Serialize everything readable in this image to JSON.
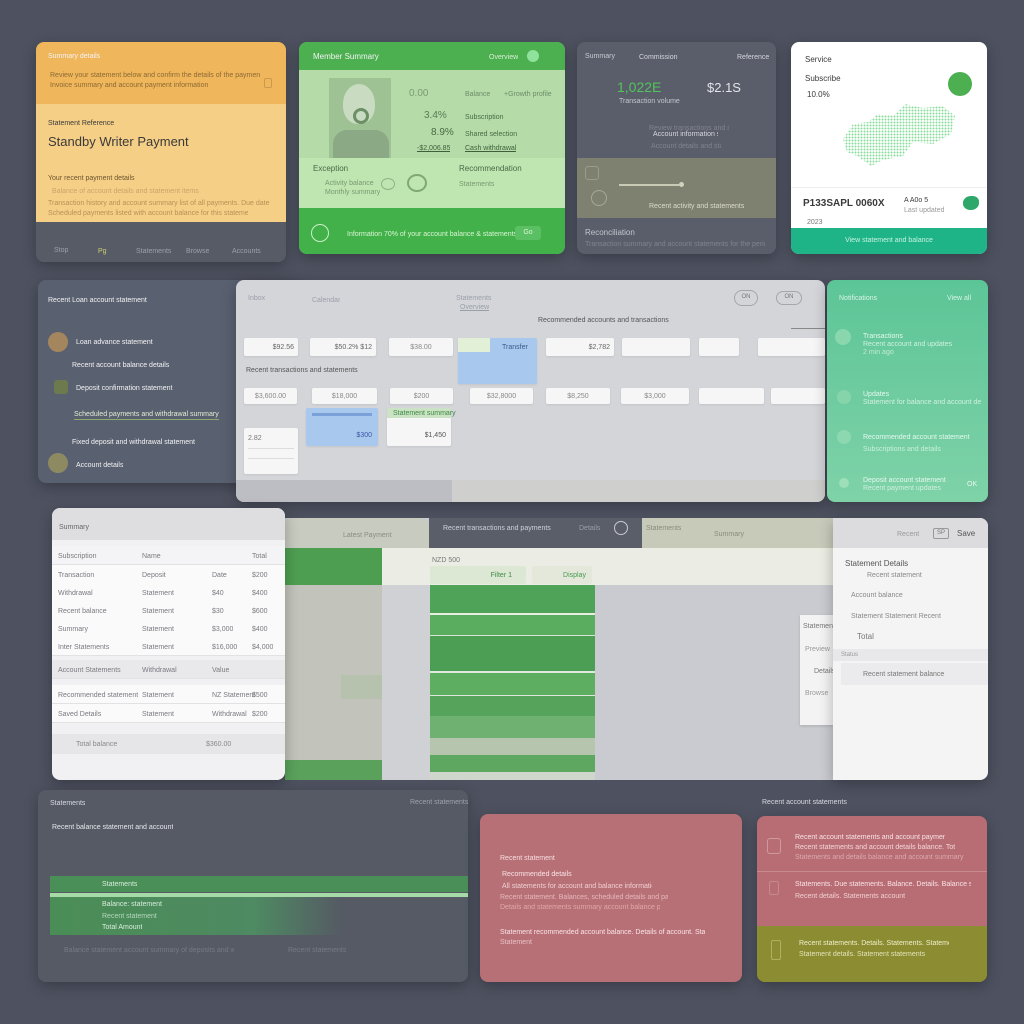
{
  "card_payment": {
    "header_label": "Summary details",
    "header_text_1": "Review your statement below and confirm the details of the payment",
    "header_text_2": "Invoice summary and account payment information",
    "section_label": "Statement Reference",
    "title": "Standby Writer Payment",
    "subtitle": "Your recent payment details",
    "line_1": "Balance of account details and statement items",
    "line_2": "Transaction history and account summary list of all payments. Due date",
    "line_3": "Scheduled payments listed with account balance for this statement",
    "footer": [
      "Stop",
      "Pg",
      "Statements",
      "Browse",
      "Accounts"
    ]
  },
  "card_profile": {
    "title": "Member Summary",
    "header_link": "Overview",
    "stat_1_value": "0.00",
    "stat_1_label": "Balance",
    "stat_1_extra": "+Growth profile",
    "stat_2_value": "3.4%",
    "stat_2_label": "Subscription",
    "stat_3_value": "8.9%",
    "stat_3_label": "Shared selection",
    "stat_4_value": "-$2,006.85",
    "stat_4_label": "Cash withdrawal",
    "section_left": "Exception",
    "section_right": "Recommendation",
    "sub_lines": [
      "Activity balance",
      "Monthly summary",
      "Statements"
    ],
    "footer_text": "Information 70% of your account balance & statements",
    "footer_button": "Go"
  },
  "card_stats": {
    "header_left": "Summary",
    "header_mid": "Commission",
    "header_right": "Reference",
    "value_green": "1,022E",
    "value_green_label": "Transaction volume",
    "value_white": "$2.1S",
    "mid_line_1": "Review transactions and recent payments",
    "mid_line_2": "Account information statement",
    "mid_line_3": "Account details and statement",
    "band_label": "Recent activity and statements",
    "footer_title": "Reconciliation",
    "footer_text": "Transaction summary and account statements for the period"
  },
  "card_map": {
    "label": "Service",
    "title": "Subscribe",
    "value": "10.0%",
    "stat_value": "P133SAPL 0060X",
    "stat_small": "A A0o 5",
    "stat_caption": "Last updated",
    "stat_foot": "2023",
    "footer_button": "View statement and balance"
  },
  "card_activity": {
    "title": "Recent Loan account statement",
    "items": [
      {
        "label": "Loan advance statement",
        "sub": "Recent account balance details"
      },
      {
        "label": "Deposit confirmation statement",
        "sub": "Scheduled payments and withdrawal summary"
      },
      {
        "label": "Fixed deposit and withdrawal statement",
        "sub": ""
      },
      {
        "label": "Account details",
        "sub": ""
      }
    ]
  },
  "card_dashboard": {
    "tab_1": "Inbox",
    "tab_2": "Calendar",
    "tab_3": "Statements",
    "tab_3_sub": "Overview",
    "header_right": "Recommended accounts and transactions",
    "section_label": "Recent transactions and statements",
    "top_tiles": [
      "$92.56",
      "$50.2% $12",
      "$38.00",
      "",
      "$2,782",
      "",
      "",
      "",
      ""
    ],
    "bottom_tiles": [
      "$3,600.00",
      "$18,000",
      "$200",
      "$32,8000",
      "$8,250",
      "$3,000",
      "",
      "",
      ""
    ],
    "blue_tile_label": "Transfer",
    "blue_tile_value": "$300",
    "green_tile_label": "Statement summary",
    "green_tile_value": "$1,450",
    "small_tile_value": "2.82",
    "toggle_1": "ON",
    "toggle_2": "ON"
  },
  "card_notifications": {
    "header": "Notifications",
    "header_right": "View all",
    "items": [
      {
        "title": "Transactions",
        "text": "Recent account and updates",
        "meta": "2 min ago"
      },
      {
        "title": "Updates",
        "text": "Statement for balance and account details",
        "meta": ""
      },
      {
        "title": "Recommended account statement",
        "text": "Subscriptions and details",
        "meta": ""
      },
      {
        "title": "Deposit account statement",
        "text": "Recent payment updates",
        "meta": "OK"
      }
    ]
  },
  "card_table": {
    "title": "Summary",
    "columns": [
      "Subscription",
      "Name",
      "",
      "Total"
    ],
    "rows": [
      [
        "Transaction",
        "Deposit",
        "Date",
        "$200"
      ],
      [
        "Withdrawal",
        "Statement",
        "$40",
        "$400"
      ],
      [
        "Recent balance",
        "Statement",
        "$30",
        "$600"
      ],
      [
        "Summary",
        "Statement",
        "$3,000",
        "$400"
      ],
      [
        "Inter Statements",
        "Statement",
        "$16,000",
        "$4,000"
      ],
      [
        "Account Statements",
        "Withdrawal",
        "Value",
        ""
      ],
      [
        "Recommended statement",
        "Statement",
        "NZ Statement",
        "$500"
      ],
      [
        "Saved Details",
        "Statement",
        "Withdrawal",
        "$200"
      ]
    ],
    "footer_label": "Total balance",
    "footer_value": "$360.00"
  },
  "card_chart_panel": {
    "tab_left": "Latest Payment",
    "tab_right": "Recent transactions and payments",
    "tab_right_meta": "Details",
    "filter_1": "NZD 500",
    "filter_2": "Filter 1",
    "filter_3": "Display",
    "right_header_1": "Statements",
    "right_header_2": "Summary",
    "popup_title": "Statement",
    "popup_items": [
      "Preview",
      "Details",
      "Browse"
    ]
  },
  "card_sidepanel": {
    "header_label": "Recent",
    "header_badge": "SP",
    "header_right": "Save",
    "title": "Statement Details",
    "lines": [
      "Recent statement",
      "Account balance",
      "Statement   Statement   Recent",
      "Total"
    ],
    "subheader": "Status",
    "footer": "Recent statement balance"
  },
  "card_bottom_dark": {
    "title": "Statements",
    "subtitle": "Recent balance statement and account",
    "header_right": "Recent statements",
    "highlight": "Statements",
    "list": [
      "Balance: statement",
      "Recent statement",
      "Total Amount"
    ],
    "footer_left": "Balance statement account summary of deposits and withdrawals in the period",
    "footer_right": "Recent statements"
  },
  "card_bottom_red": {
    "label": "Recent statement",
    "title": "Recommended details",
    "lines": [
      "All statements for account and balance information",
      "Recent statement. Balances, scheduled details and payment",
      "Details and statements summary account balance period"
    ],
    "note": "Statement recommended account balance. Details of account. Statement",
    "note_sub": "Statement"
  },
  "card_bottom_alerts": {
    "title": "Recent account statements",
    "items": [
      {
        "text": "Recent account statements and account payments",
        "sub": "Recent statements and account details balance. Total",
        "meta": "Statements and details balance and account summary"
      },
      {
        "text": "Statements. Due statements. Balance. Details. Balance statement",
        "sub": "Recent details. Statements account",
        "meta": ""
      },
      {
        "text": "Recent statements. Details. Statements. Statements",
        "sub": "Statement details. Statement statements",
        "meta": ""
      }
    ]
  },
  "colors": {
    "background": "#4e5260",
    "orange": "#f0b65c",
    "green": "#4caf50",
    "teal": "#1fb487",
    "mint": "#5cc597",
    "red": "#b87077",
    "olive": "#8c8c33"
  }
}
